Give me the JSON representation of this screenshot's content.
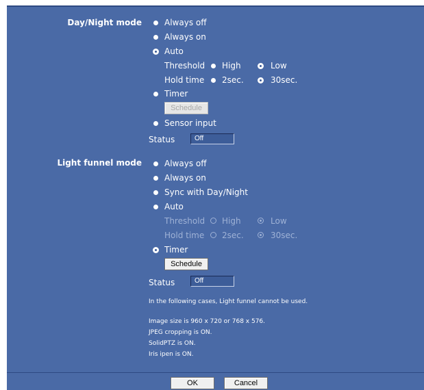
{
  "day_night": {
    "label": "Day/Night mode",
    "options": [
      "Always off",
      "Always on",
      "Auto"
    ],
    "threshold": {
      "label": "Threshold",
      "high": "High",
      "low": "Low"
    },
    "hold_time": {
      "label": "Hold time",
      "short": "2sec.",
      "long": "30sec."
    },
    "timer": "Timer",
    "schedule_button": "Schedule",
    "sensor_input": "Sensor input",
    "status_label": "Status",
    "status_value": "Off"
  },
  "light_funnel": {
    "label": "Light funnel mode",
    "options": [
      "Always off",
      "Always on",
      "Sync with Day/Night",
      "Auto"
    ],
    "threshold": {
      "label": "Threshold",
      "high": "High",
      "low": "Low"
    },
    "hold_time": {
      "label": "Hold time",
      "short": "2sec.",
      "long": "30sec."
    },
    "timer": "Timer",
    "schedule_button": "Schedule",
    "status_label": "Status",
    "status_value": "Off"
  },
  "notes": {
    "intro": "In the following cases, Light funnel cannot be used.",
    "items": [
      "Image size is 960 x 720 or 768 x 576.",
      "JPEG cropping is ON.",
      "SolidPTZ is ON.",
      "Iris ipen is ON."
    ]
  },
  "footer": {
    "ok": "OK",
    "cancel": "Cancel"
  }
}
